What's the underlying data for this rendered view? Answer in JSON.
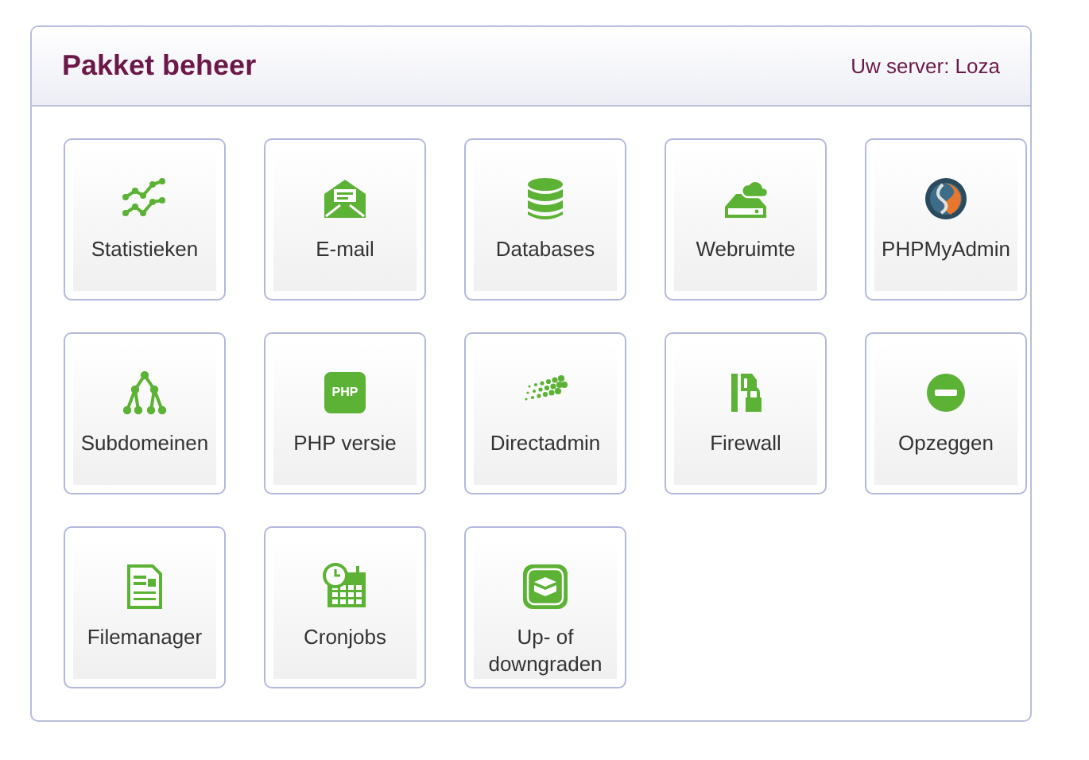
{
  "panel": {
    "title": "Pakket beheer",
    "server_info": "Uw server: Loza"
  },
  "tiles": [
    {
      "kind": "stats",
      "label": "Statistieken"
    },
    {
      "kind": "mail",
      "label": "E-mail"
    },
    {
      "kind": "database",
      "label": "Databases"
    },
    {
      "kind": "cloud",
      "label": "Webruimte"
    },
    {
      "kind": "sail",
      "label": "PHPMyAdmin"
    },
    {
      "kind": "tree",
      "label": "Subdomeinen"
    },
    {
      "kind": "badge",
      "label": "PHP versie",
      "icon_text": "PHP"
    },
    {
      "kind": "dots",
      "label": "Directadmin"
    },
    {
      "kind": "lock",
      "label": "Firewall"
    },
    {
      "kind": "minus",
      "label": "Opzeggen"
    },
    {
      "kind": "document",
      "label": "Filemanager"
    },
    {
      "kind": "calendar",
      "label": "Cronjobs"
    },
    {
      "kind": "box",
      "label": "Up- of downgraden"
    }
  ]
}
